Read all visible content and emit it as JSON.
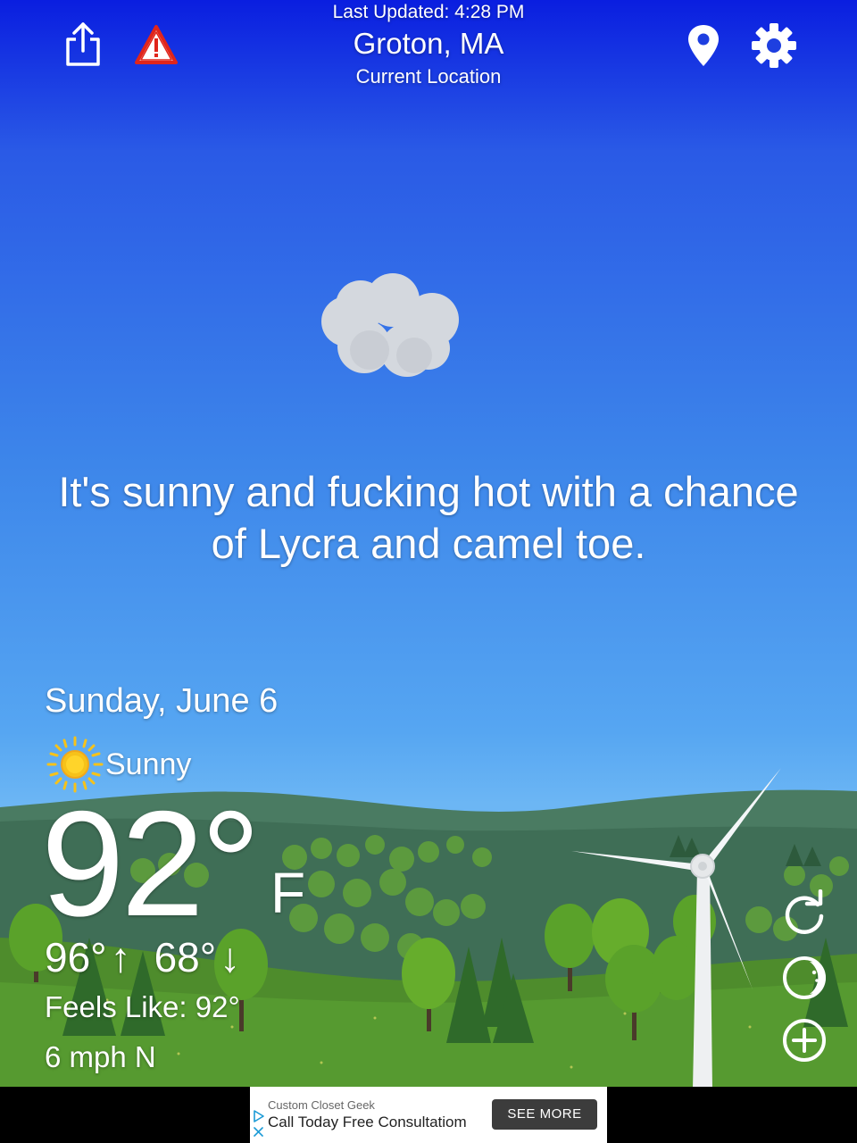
{
  "header": {
    "last_updated": "Last Updated: 4:28 PM",
    "city": "Groton, MA",
    "location_label": "Current Location"
  },
  "icons": {
    "share": "share-icon",
    "alert": "warning-triangle-icon",
    "location": "map-pin-icon",
    "settings": "gear-icon",
    "refresh": "refresh-icon",
    "moon": "moon-icon",
    "add": "plus-circle-icon",
    "condition": "sun-icon"
  },
  "message": "It's sunny and fucking hot with a chance of Lycra and camel toe.",
  "weather": {
    "date": "Sunday, June 6",
    "condition": "Sunny",
    "temperature": "92°",
    "unit": "F",
    "high": "96°",
    "high_arrow": "↑",
    "low": "68°",
    "low_arrow": "↓",
    "feels_like": "Feels Like: 92°",
    "wind": "6 mph N"
  },
  "ad": {
    "sponsor": "Custom Closet Geek",
    "headline": "Call Today Free Consultatiom",
    "cta": "SEE MORE"
  },
  "colors": {
    "sky_top": "#0a1ee0",
    "sky_bottom": "#6cb6f4",
    "hills": "#3d6b55",
    "grass": "#4e8c2c",
    "alert_red": "#e0251b",
    "sun_yellow": "#f6c21a"
  }
}
